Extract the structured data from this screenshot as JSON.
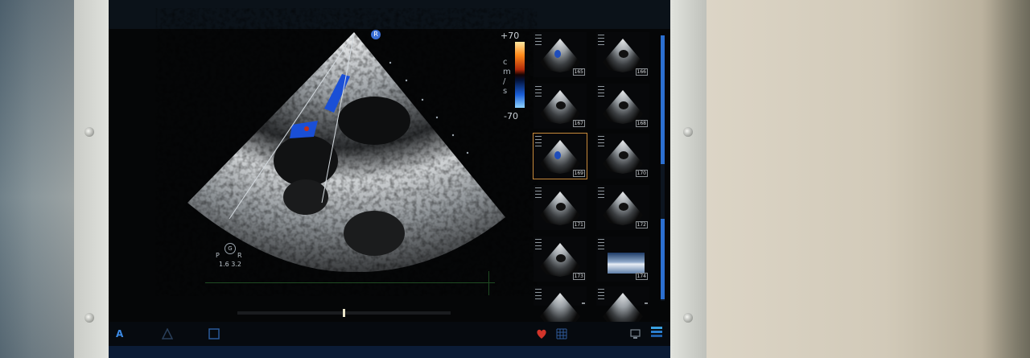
{
  "scale": {
    "max_label": "+70",
    "min_label": "-70",
    "unit_letters": [
      "c",
      "m",
      "/",
      "s"
    ]
  },
  "orientation": {
    "top": "G",
    "left": "P",
    "right": "R",
    "values": "1.6  3.2"
  },
  "thumbnails": [
    {
      "number": "165"
    },
    {
      "number": "166"
    },
    {
      "number": "167"
    },
    {
      "number": "168"
    },
    {
      "number": "169"
    },
    {
      "number": "170"
    },
    {
      "number": "171"
    },
    {
      "number": "172"
    },
    {
      "number": "173"
    },
    {
      "number": "174"
    },
    {
      "number": ""
    },
    {
      "number": ""
    }
  ],
  "bottom_toolbar": {
    "a_label": "A"
  },
  "colors": {
    "accent_blue": "#2b6fd0",
    "selection_orange": "#c88a3a",
    "flow_blue": "#1a4fd6",
    "flow_red": "#c0301a"
  },
  "icons": [
    "probe-icon",
    "heart-icon",
    "grid-icon",
    "screen-icon",
    "layers-icon",
    "triangle-icon",
    "square-icon"
  ]
}
